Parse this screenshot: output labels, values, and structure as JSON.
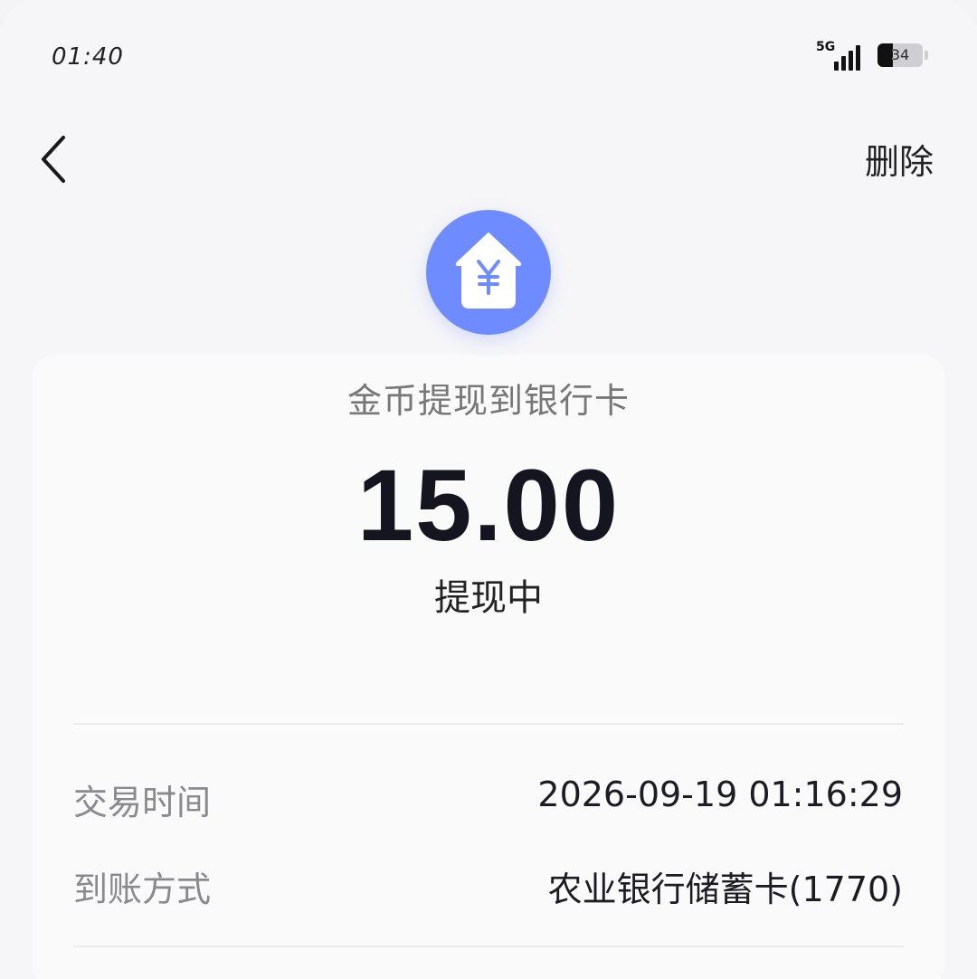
{
  "status_bar": {
    "time": "01:40",
    "network": "5G",
    "battery_level": "34"
  },
  "nav": {
    "delete_label": "删除"
  },
  "header": {
    "icon": "yuan-house-icon",
    "accent_color": "#6e8bff"
  },
  "transaction": {
    "title": "金币提现到银行卡",
    "amount": "15.00",
    "status": "提现中"
  },
  "details": [
    {
      "label": "交易时间",
      "value": "2026-09-19 01:16:29"
    },
    {
      "label": "到账方式",
      "value": "农业银行储蓄卡(1770)"
    }
  ]
}
